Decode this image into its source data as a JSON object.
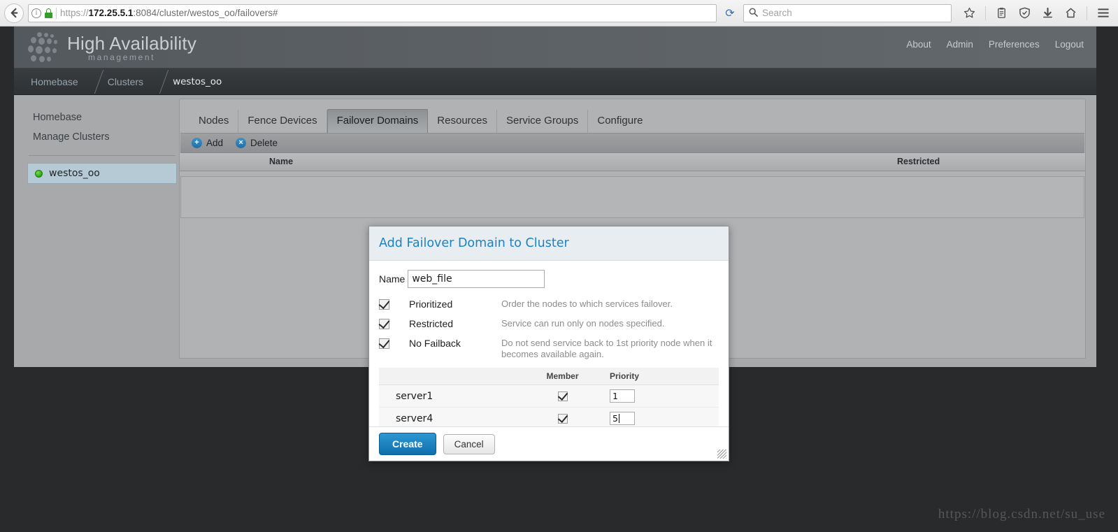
{
  "browser": {
    "back_icon": "back-arrow-icon",
    "info_icon": "info-icon",
    "lock_icon": "lock-icon",
    "url_scheme": "https://",
    "url_host": "172.25.5.1",
    "url_rest": ":8084/cluster/westos_oo/failovers#",
    "reload_glyph": "⟳",
    "search_placeholder": "Search",
    "search_icon": "search-icon",
    "toolbar_icons": [
      "bookmark-star-icon",
      "pocket-clipboard-icon",
      "shield-icon",
      "download-icon",
      "home-icon",
      "menu-hamburger-icon"
    ]
  },
  "header": {
    "brand_title": "High Availability",
    "brand_subtitle": "management",
    "nav": [
      {
        "label": "About"
      },
      {
        "label": "Admin"
      },
      {
        "label": "Preferences"
      },
      {
        "label": "Logout"
      }
    ]
  },
  "breadcrumb": {
    "items": [
      {
        "label": "Homebase"
      },
      {
        "label": "Clusters"
      },
      {
        "label": "westos_oo"
      }
    ]
  },
  "sidebar": {
    "links": [
      {
        "label": "Homebase"
      },
      {
        "label": "Manage Clusters"
      }
    ],
    "cluster": {
      "name": "westos_oo",
      "status_color": "#2aa515"
    }
  },
  "panel": {
    "tabs": [
      {
        "label": "Nodes",
        "active": false
      },
      {
        "label": "Fence Devices",
        "active": false
      },
      {
        "label": "Failover Domains",
        "active": true
      },
      {
        "label": "Resources",
        "active": false
      },
      {
        "label": "Service Groups",
        "active": false
      },
      {
        "label": "Configure",
        "active": false
      }
    ],
    "toolbar": {
      "add_label": "Add",
      "add_glyph": "+",
      "delete_label": "Delete",
      "delete_glyph": "×"
    },
    "table_headers": {
      "name": "Name",
      "restricted": "Restricted"
    }
  },
  "modal": {
    "title": "Add Failover Domain to Cluster",
    "name_label": "Name",
    "name_value": "web_file",
    "options": [
      {
        "label": "Prioritized",
        "desc": "Order the nodes to which services failover.",
        "checked": true
      },
      {
        "label": "Restricted",
        "desc": "Service can run only on nodes specified.",
        "checked": true
      },
      {
        "label": "No Failback",
        "desc": "Do not send service back to 1st priority node when it becomes available again.",
        "checked": true
      }
    ],
    "member_table": {
      "headers": {
        "member": "Member",
        "priority": "Priority"
      },
      "rows": [
        {
          "name": "server1",
          "member_checked": true,
          "priority": "1",
          "focused": false
        },
        {
          "name": "server4",
          "member_checked": true,
          "priority": "5",
          "focused": true
        }
      ]
    },
    "create_label": "Create",
    "cancel_label": "Cancel",
    "accent_color": "#1c82c4"
  },
  "watermark": {
    "text": "https://blog.csdn.net/su_use"
  }
}
